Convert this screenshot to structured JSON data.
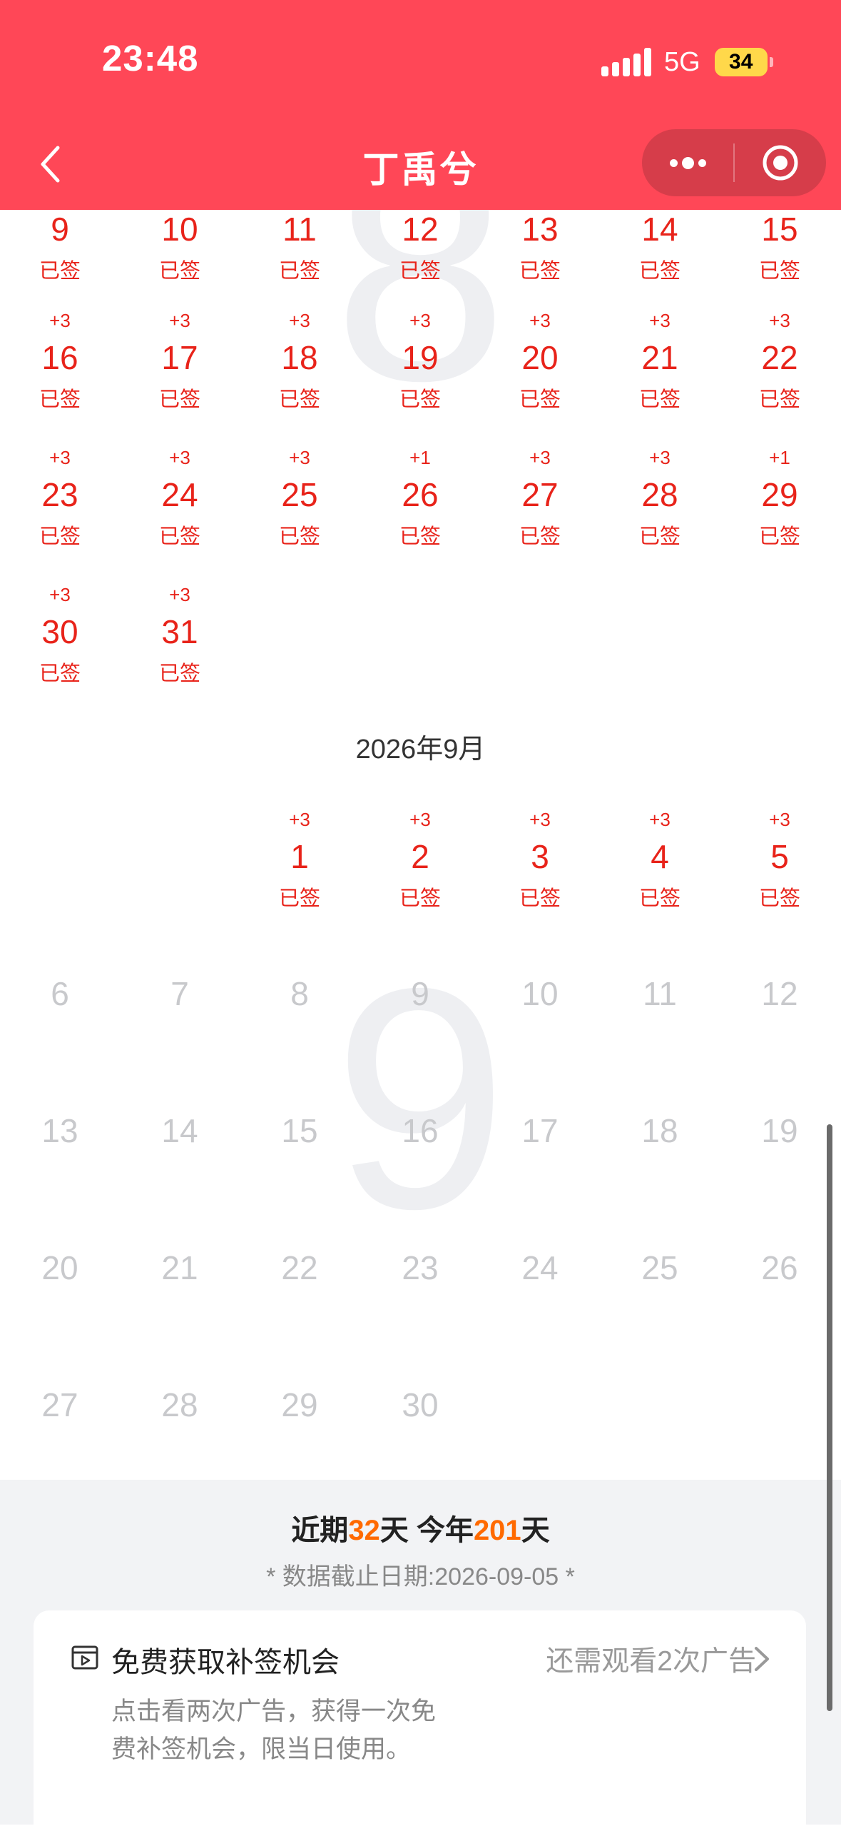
{
  "status_bar": {
    "time": "23:48",
    "network": "5G",
    "battery": "34"
  },
  "nav": {
    "title": "丁禹兮",
    "more_icon": "ellipsis-icon",
    "target_icon": "target-icon",
    "back_icon": "chevron-left-icon"
  },
  "august": {
    "big_number": "8",
    "weeks": [
      [
        {
          "plus": "",
          "day": "9",
          "status": "已签"
        },
        {
          "plus": "",
          "day": "10",
          "status": "已签"
        },
        {
          "plus": "",
          "day": "11",
          "status": "已签"
        },
        {
          "plus": "",
          "day": "12",
          "status": "已签"
        },
        {
          "plus": "",
          "day": "13",
          "status": "已签"
        },
        {
          "plus": "",
          "day": "14",
          "status": "已签"
        },
        {
          "plus": "",
          "day": "15",
          "status": "已签"
        }
      ],
      [
        {
          "plus": "+3",
          "day": "16",
          "status": "已签"
        },
        {
          "plus": "+3",
          "day": "17",
          "status": "已签"
        },
        {
          "plus": "+3",
          "day": "18",
          "status": "已签"
        },
        {
          "plus": "+3",
          "day": "19",
          "status": "已签"
        },
        {
          "plus": "+3",
          "day": "20",
          "status": "已签"
        },
        {
          "plus": "+3",
          "day": "21",
          "status": "已签"
        },
        {
          "plus": "+3",
          "day": "22",
          "status": "已签"
        }
      ],
      [
        {
          "plus": "+3",
          "day": "23",
          "status": "已签"
        },
        {
          "plus": "+3",
          "day": "24",
          "status": "已签"
        },
        {
          "plus": "+3",
          "day": "25",
          "status": "已签"
        },
        {
          "plus": "+1",
          "day": "26",
          "status": "已签"
        },
        {
          "plus": "+3",
          "day": "27",
          "status": "已签"
        },
        {
          "plus": "+3",
          "day": "28",
          "status": "已签"
        },
        {
          "plus": "+1",
          "day": "29",
          "status": "已签"
        }
      ],
      [
        {
          "plus": "+3",
          "day": "30",
          "status": "已签"
        },
        {
          "plus": "+3",
          "day": "31",
          "status": "已签"
        }
      ]
    ]
  },
  "september": {
    "title": "2026年9月",
    "big_number": "9",
    "weeks": [
      [
        null,
        null,
        {
          "plus": "+3",
          "day": "1",
          "status": "已签"
        },
        {
          "plus": "+3",
          "day": "2",
          "status": "已签"
        },
        {
          "plus": "+3",
          "day": "3",
          "status": "已签"
        },
        {
          "plus": "+3",
          "day": "4",
          "status": "已签"
        },
        {
          "plus": "+3",
          "day": "5",
          "status": "已签"
        }
      ],
      [
        {
          "day": "6",
          "future": true
        },
        {
          "day": "7",
          "future": true
        },
        {
          "day": "8",
          "future": true
        },
        {
          "day": "9",
          "future": true
        },
        {
          "day": "10",
          "future": true
        },
        {
          "day": "11",
          "future": true
        },
        {
          "day": "12",
          "future": true
        }
      ],
      [
        {
          "day": "13",
          "future": true
        },
        {
          "day": "14",
          "future": true
        },
        {
          "day": "15",
          "future": true
        },
        {
          "day": "16",
          "future": true
        },
        {
          "day": "17",
          "future": true
        },
        {
          "day": "18",
          "future": true
        },
        {
          "day": "19",
          "future": true
        }
      ],
      [
        {
          "day": "20",
          "future": true
        },
        {
          "day": "21",
          "future": true
        },
        {
          "day": "22",
          "future": true
        },
        {
          "day": "23",
          "future": true
        },
        {
          "day": "24",
          "future": true
        },
        {
          "day": "25",
          "future": true
        },
        {
          "day": "26",
          "future": true
        }
      ],
      [
        {
          "day": "27",
          "future": true
        },
        {
          "day": "28",
          "future": true
        },
        {
          "day": "29",
          "future": true
        },
        {
          "day": "30",
          "future": true
        }
      ]
    ]
  },
  "summary": {
    "recent_prefix": "近期",
    "recent_days": "32",
    "recent_suffix": "天",
    "year_prefix": "今年",
    "year_days": "201",
    "year_suffix": "天",
    "cutoff": "* 数据截止日期:2026-09-05 *"
  },
  "card": {
    "icon": "video-icon",
    "title": "免费获取补签机会",
    "link": "还需观看2次广告",
    "desc": "点击看两次广告，获得一次免费补签机会，限当日使用。"
  },
  "colors": {
    "header": "#ff4757",
    "signed": "#e8231a",
    "future": "#c8c9cc",
    "highlight": "#ff6a00"
  }
}
